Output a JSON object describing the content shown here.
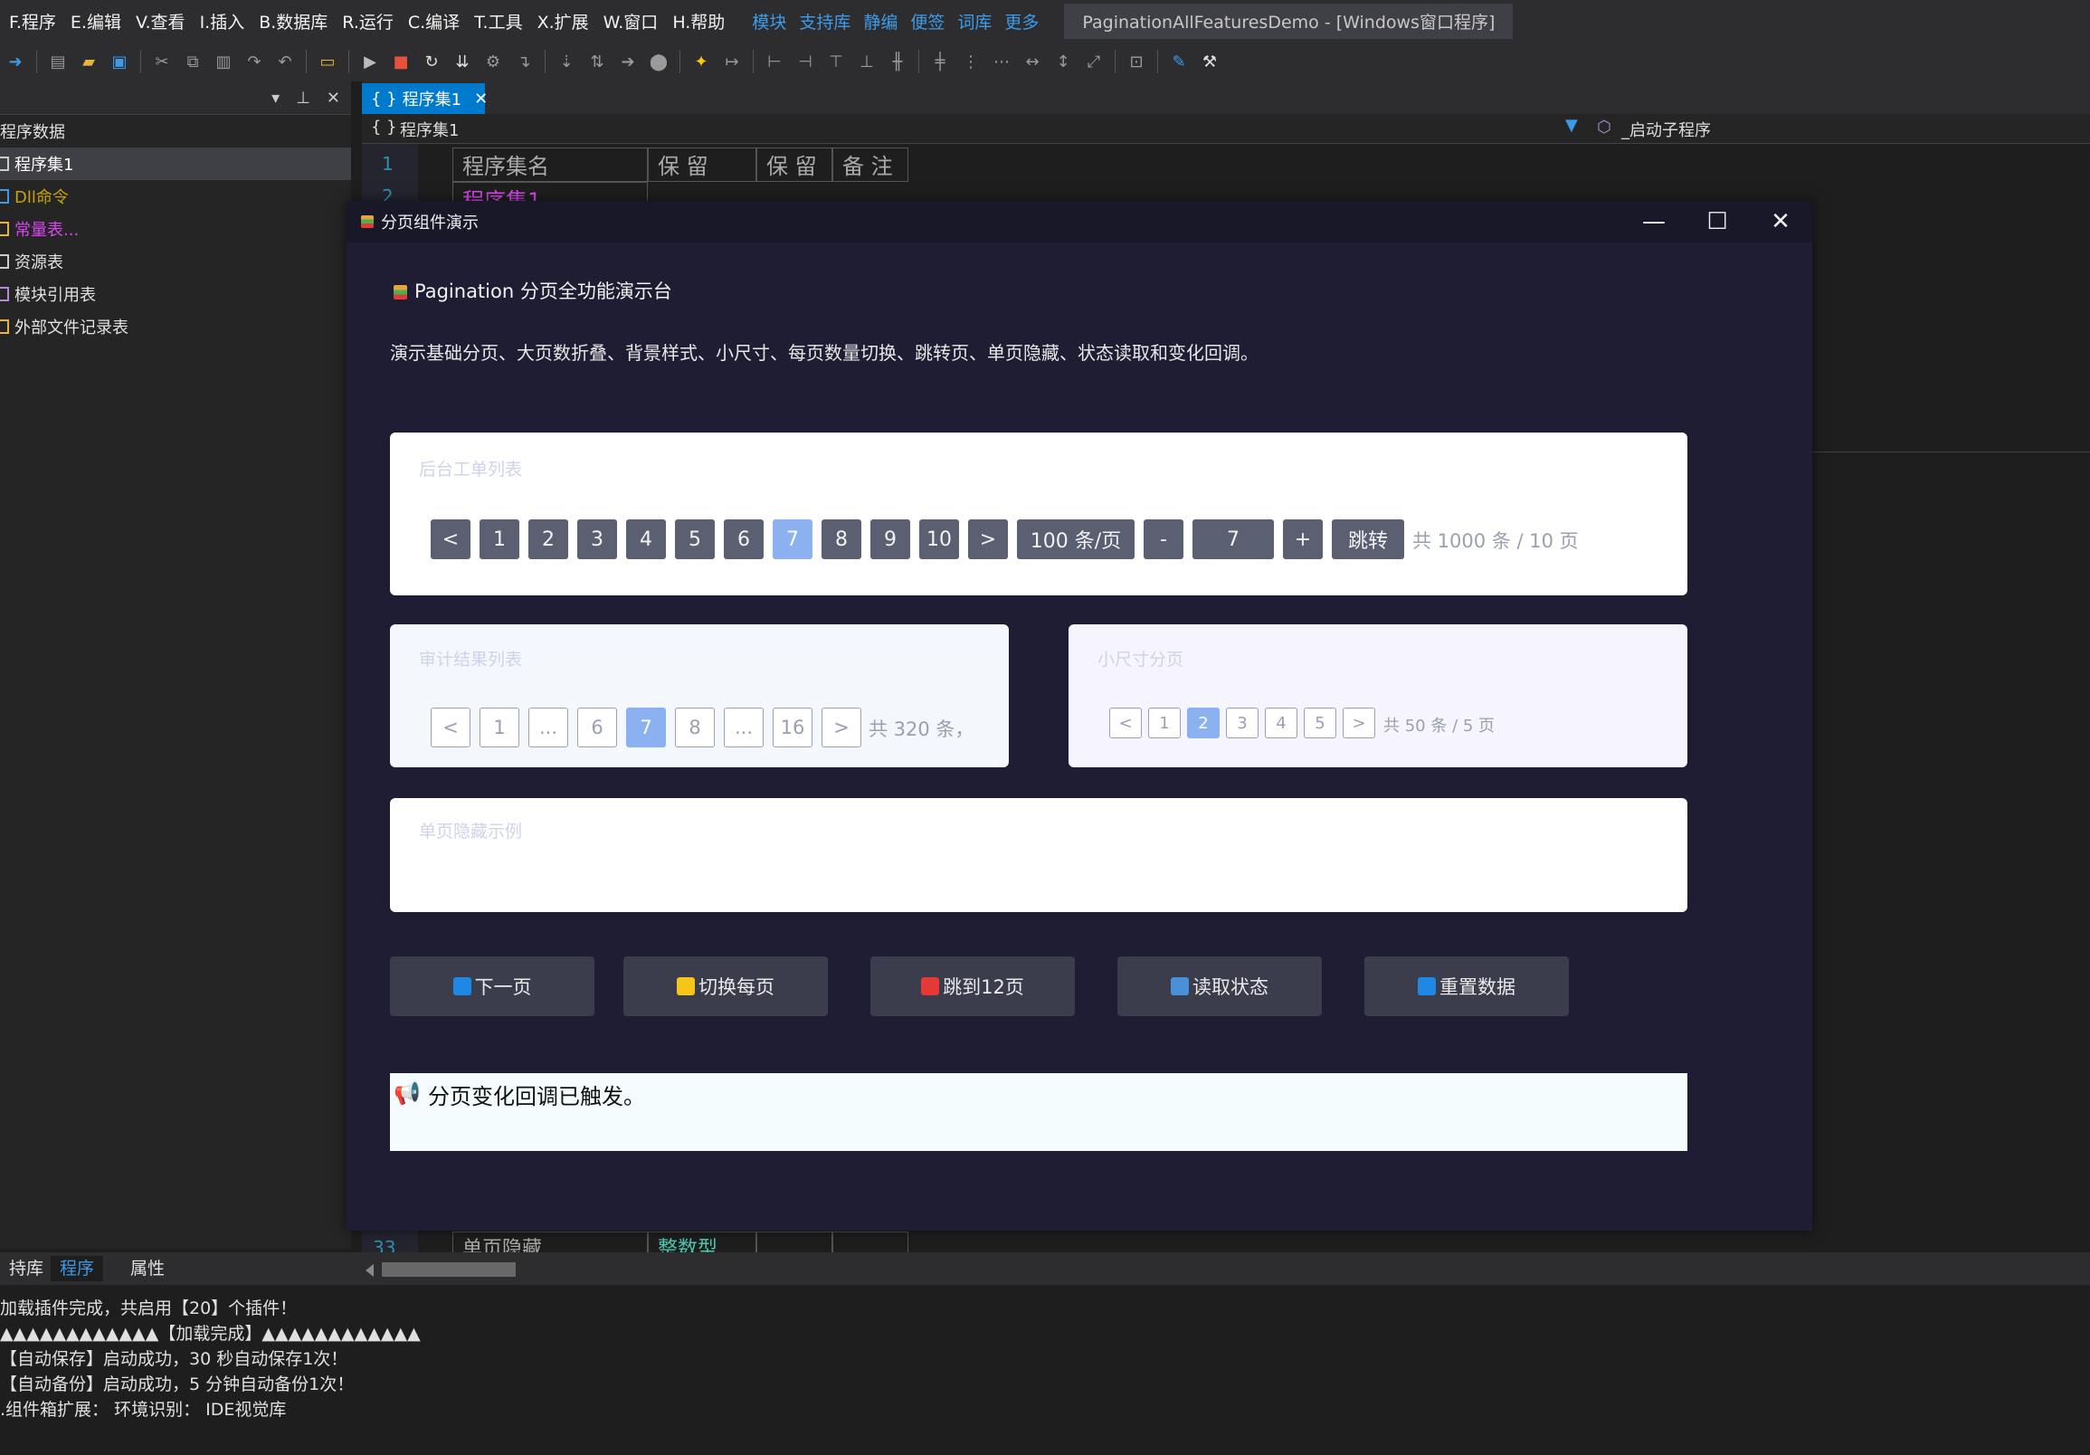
{
  "menu": {
    "items": [
      "F.程序",
      "E.编辑",
      "V.查看",
      "I.插入",
      "B.数据库",
      "R.运行",
      "C.编译",
      "T.工具",
      "X.扩展",
      "W.窗口",
      "H.帮助"
    ],
    "links": [
      "模块",
      "支持库",
      "静编",
      "便签",
      "词库",
      "更多"
    ],
    "window_title": "PaginationAllFeaturesDemo - [Windows窗口程序]"
  },
  "toolbar": {
    "icons": [
      "go-icon",
      "new-icon",
      "open-icon",
      "save-icon",
      "cut-icon",
      "copy-icon",
      "paste-icon",
      "redo-icon",
      "undo-icon",
      "folder-icon",
      "run-icon",
      "stop-icon",
      "restart-icon",
      "compile-icon",
      "debug-icon",
      "step-icon",
      "step-over-icon",
      "step-into-icon",
      "step-out-icon",
      "breakpoint-icon",
      "bulb-icon",
      "goto-icon",
      "align-left-icon",
      "align-right-icon",
      "align-top-icon",
      "align-bottom-icon",
      "h-center-icon",
      "v-center-icon",
      "h-space-icon",
      "v-space-icon",
      "same-width-icon",
      "same-height-icon",
      "same-size-icon",
      "fit-icon",
      "wand-icon",
      "tools-icon"
    ]
  },
  "left_panel": {
    "tree": [
      {
        "label": "程序数据",
        "color": "#e0e0e0",
        "indent": 0
      },
      {
        "label": "程序集1",
        "color": "#ffffff",
        "indent": 1,
        "selected": true
      },
      {
        "label": "Dll命令",
        "color": "#c9a400",
        "indent": 1
      },
      {
        "label": "常量表...",
        "color": "#d946ef",
        "indent": 1
      },
      {
        "label": "资源表",
        "color": "#e0e0e0",
        "indent": 1
      },
      {
        "label": "模块引用表",
        "color": "#e0e0e0",
        "indent": 1
      },
      {
        "label": "外部文件记录表",
        "color": "#e0e0e0",
        "indent": 1
      }
    ]
  },
  "editor": {
    "tab_label": "程序集1",
    "nav_left": "程序集1",
    "nav_right": "_启动子程序",
    "line_first": "1",
    "line_second": "2",
    "line_last": "33",
    "headers": [
      "程序集名",
      "保 留",
      "保 留",
      "备 注"
    ],
    "row1_name": "程序集1",
    "last_row_name": "单页隐藏",
    "last_row_type": "整数型"
  },
  "dialog": {
    "title": "分页组件演示",
    "heading": "Pagination 分页全功能演示台",
    "description": "演示基础分页、大页数折叠、背景样式、小尺寸、每页数量切换、跳转页、单页隐藏、状态读取和变化回调。",
    "card1": {
      "title": "后台工单列表",
      "prev": "<",
      "pages": [
        "1",
        "2",
        "3",
        "4",
        "5",
        "6",
        "7",
        "8",
        "9",
        "10"
      ],
      "active_page": "7",
      "next": ">",
      "page_size": "100 条/页",
      "minus": "-",
      "jump_value": "7",
      "plus": "+",
      "jump_label": "跳转",
      "total": "共 1000 条 / 10 页"
    },
    "card2": {
      "title": "审计结果列表",
      "items": [
        "<",
        "1",
        "...",
        "6",
        "7",
        "8",
        "...",
        "16",
        ">"
      ],
      "active_page": "7",
      "total": "共 320 条，"
    },
    "card3": {
      "title": "小尺寸分页",
      "items": [
        "<",
        "1",
        "2",
        "3",
        "4",
        "5",
        ">"
      ],
      "active_page": "2",
      "total": "共 50 条 / 5 页"
    },
    "card4": {
      "title": "单页隐藏示例"
    },
    "actions": [
      {
        "label": "下一页",
        "icon": "arrow-right-icon",
        "color": "#1e88e5"
      },
      {
        "label": "切换每页",
        "icon": "ruler-icon",
        "color": "#f5c518"
      },
      {
        "label": "跳到12页",
        "icon": "target-icon",
        "color": "#e53935"
      },
      {
        "label": "读取状态",
        "icon": "chart-icon",
        "color": "#4a90d9"
      },
      {
        "label": "重置数据",
        "icon": "refresh-icon",
        "color": "#1e88e5"
      }
    ],
    "callback_message": "分页变化回调已触发。"
  },
  "bottom_tabs": [
    "持库",
    "程序",
    "属性"
  ],
  "active_bottom_tab": "程序",
  "output_lines": [
    "加载插件完成，共启用【20】个插件！",
    "▲▲▲▲▲▲▲▲▲▲▲▲【加载完成】▲▲▲▲▲▲▲▲▲▲▲▲",
    "【自动保存】启动成功，30 秒自动保存1次！",
    "【自动备份】启动成功，5 分钟自动备份1次！",
    ".组件箱扩展：  环境识别：  IDE视觉库"
  ]
}
